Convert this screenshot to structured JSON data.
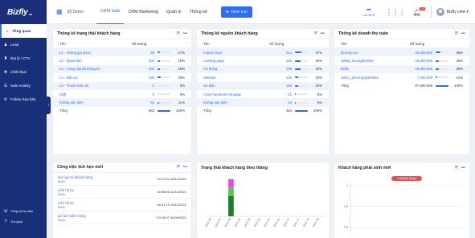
{
  "app": {
    "logo": "Bizfly",
    "logo_sub": ".vn"
  },
  "sidebar": {
    "items": [
      {
        "icon": "home-icon",
        "glyph": "⌂",
        "label": "Tổng quan"
      },
      {
        "icon": "lead-icon",
        "glyph": "♟",
        "label": "Lead"
      },
      {
        "icon": "agency-icon",
        "glyph": "♜",
        "label": "Đại lý / CTV"
      },
      {
        "icon": "deal-icon",
        "glyph": "✚",
        "label": "Chốt đoal"
      },
      {
        "icon": "activity-icon",
        "glyph": "☰",
        "label": "Sale Activity"
      },
      {
        "icon": "follow-icon",
        "glyph": "⟳",
        "label": "Follow Sau bán"
      }
    ],
    "bottom": [
      {
        "icon": "support-icon",
        "glyph": "☏",
        "label": "Tổng hỗ trợ liên"
      },
      {
        "icon": "help-icon",
        "glyph": "?",
        "label": "Trợ giúp"
      }
    ]
  },
  "topbar": {
    "company": "[0] Demo",
    "tabs": [
      "CRM Sale",
      "CRM Marketing",
      "Quản lý",
      "Thống kê"
    ],
    "active_tab": "CRM Sale",
    "add_button": "Thêm mới",
    "workspace": "Lời đề ▾",
    "badge": "24",
    "user": "Bizfly view ▾"
  },
  "colors": {
    "primary": "#2f6cf0",
    "sidebar": "#1a2f7a"
  },
  "cards": {
    "status": {
      "title": "Thống kê trạng thái khách hàng",
      "col_name": "Tên",
      "col_count": "Số lượng",
      "rows": [
        {
          "name": "L1 - Không gọi được",
          "count": "96",
          "pct": "17%",
          "w": 17
        },
        {
          "name": "L2 - Quan tâm",
          "count": "101",
          "pct": "18%",
          "w": 18
        },
        {
          "name": "L3 - Cung cấp đủ thông tin",
          "count": "102",
          "pct": "18%",
          "w": 18
        },
        {
          "name": "L4 - Đặt cọc",
          "count": "195",
          "pct": "25%",
          "w": 25
        },
        {
          "name": "L5 - Thanh toán đủ",
          "count": "0",
          "pct": "0%",
          "w": 0
        },
        {
          "name": "(fsjf)",
          "count": "0",
          "pct": "0%",
          "w": 0
        },
        {
          "name": "Không xác định",
          "count": "61",
          "pct": "11%",
          "w": 11
        },
        {
          "name": "Tổng",
          "count": "562",
          "pct": "100%",
          "w": 100,
          "total": true
        }
      ]
    },
    "source": {
      "title": "Thống kê nguồn khách hàng",
      "col_name": "Tên",
      "col_count": "Số lượng",
      "rows": [
        {
          "name": "Import excel",
          "count": "214",
          "pct": "47%",
          "w": 47
        },
        {
          "name": "Landing page",
          "count": "195",
          "pct": "43%",
          "w": 43
        },
        {
          "name": "Hệ thống",
          "count": "195",
          "pct": "43%",
          "w": 43
        },
        {
          "name": "Website",
          "count": "100",
          "pct": "22%",
          "w": 22
        },
        {
          "name": "Sự kiện",
          "count": "100",
          "pct": "22%",
          "w": 22
        },
        {
          "name": "Chat Facebook Fanpage",
          "count": "21",
          "pct": "5%",
          "w": 5
        },
        {
          "name": "Không xác định",
          "count": "24",
          "pct": "5%",
          "w": 5
        },
        {
          "name": "Tổng",
          "count": "453",
          "pct": "100%",
          "w": 100,
          "total": true
        }
      ]
    },
    "revenue": {
      "title": "Thống kê doanh thu tuần",
      "col_name": "Tên",
      "col_count": "Số lượng",
      "rows": [
        {
          "name": "Dương Acc",
          "count": "20.000.000",
          "pct": "35%",
          "w": 35
        },
        {
          "name": "vidl50_huongphamthi",
          "count": "15.000.000",
          "pct": "26%",
          "w": 26
        },
        {
          "name": "Bizfly",
          "count": "15.000.000",
          "pct": "26%",
          "w": 26
        },
        {
          "name": "vidl12_phuongngothithia",
          "count": "7.000.000",
          "pct": "12%",
          "w": 12
        },
        {
          "name": "Tổng",
          "count": "57.000.000",
          "pct": "100%",
          "w": 100,
          "total": true
        }
      ]
    },
    "schedule": {
      "title": "Công việc lịch hẹn mới",
      "items": [
        {
          "title": "hẹn gọi lại khách hàng",
          "sub": "Bizfly",
          "date": "22:01:54 18/12/2021"
        },
        {
          "title": "Liên hệ lại",
          "sub": "Bizfly",
          "date": "16:58:06 14/10/2021"
        },
        {
          "title": "Liên hệ lại",
          "sub": "Bizfly",
          "date": "16:57:19 14/10/2021"
        },
        {
          "title": "gọi lại khách hàng",
          "sub": "Bizfly",
          "date": "20:26:07 30/09/2021"
        }
      ]
    },
    "monthly": {
      "title": "Trạng thái khách hàng theo tháng"
    },
    "new_customers": {
      "title": "Khách hàng phát sinh mới"
    }
  },
  "chart_data": [
    {
      "type": "bar",
      "categories": [
        "2022-08",
        "2022-07",
        "2022-06",
        "2022-05",
        "2022-04",
        "2022-03",
        "2022-02",
        "2022-01",
        "2021-12",
        "2021-11",
        "2021-10",
        "2021-09"
      ],
      "series": [
        {
          "color": "#1e7a2e",
          "values": [
            0,
            0,
            20,
            0,
            0,
            0,
            0,
            0,
            0,
            0,
            0,
            0
          ]
        },
        {
          "color": "#5cc15a",
          "values": [
            0,
            0,
            9,
            0,
            0,
            0,
            0,
            0,
            0,
            0,
            0,
            0
          ]
        },
        {
          "color": "#e04fd6",
          "values": [
            0,
            0,
            8,
            0,
            0,
            0,
            0,
            0,
            0,
            0,
            0,
            0
          ]
        }
      ],
      "ylim": [
        0,
        40
      ]
    },
    {
      "type": "line",
      "legend": "0 Khách hàng",
      "y_ticks": [
        "1",
        "0.8",
        "0.6"
      ],
      "ylim": [
        0.5,
        1
      ],
      "grid": true
    }
  ]
}
